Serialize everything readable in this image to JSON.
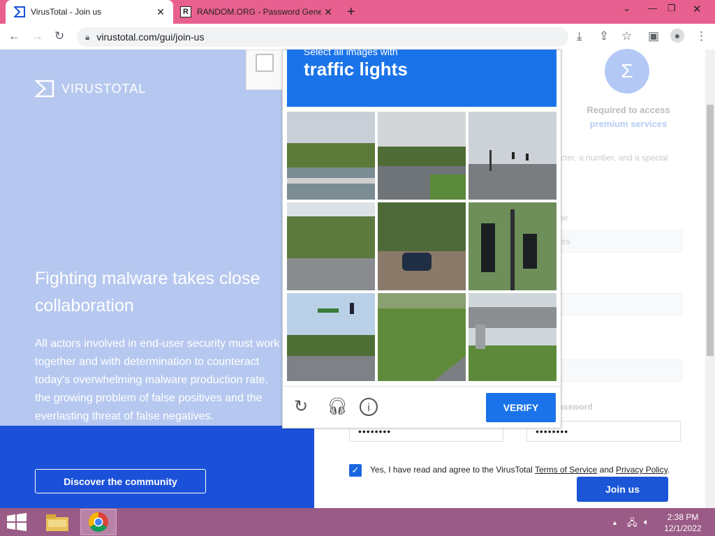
{
  "browser": {
    "tabs": [
      {
        "title": "VirusTotal - Join us",
        "active": true
      },
      {
        "title": "RANDOM.ORG - Password Gene",
        "active": false
      }
    ],
    "url": "virustotal.com/gui/join-us"
  },
  "left_panel": {
    "logo_text": "VIRUSTOTAL",
    "headline": "Fighting malware takes close collaboration",
    "body": "All actors involved in end-user security must work together and with determination to counteract today's overwhelming malware production rate, the growing problem of false positives and the everlasting threat of false negatives.",
    "discover_button": "Discover the community"
  },
  "right_panel": {
    "required_line1": "Required to access",
    "required_line2": "premium services",
    "password_hint": "cter, a number, and a special",
    "label_name": "ne",
    "label_letters": "ers",
    "confirm_password_label": "assword",
    "password_value": "••••••••",
    "confirm_value": "••••••••",
    "agree_prefix": "Yes, I have read and agree to the VirusTotal",
    "terms_link": "Terms of Service",
    "and": "and",
    "privacy_link": "Privacy Policy",
    "period": ".",
    "join_button": "Join us"
  },
  "captcha": {
    "instruction": "Select all images with",
    "target": "traffic lights",
    "verify_button": "VERIFY",
    "tiles": [
      "palm trees waterfront road",
      "road with trees",
      "road intersection traffic lights",
      "palm trees street",
      "car on road under trees",
      "traffic lights closeup",
      "street with traffic lights",
      "grass roadside",
      "highway overpass"
    ]
  },
  "taskbar": {
    "time": "2:38 PM",
    "date": "12/1/2022"
  },
  "colors": {
    "tabstrip": "#e8608f",
    "vt_blue": "#1b51d9",
    "captcha_blue": "#1a73e8",
    "taskbar": "#9a5b86"
  }
}
